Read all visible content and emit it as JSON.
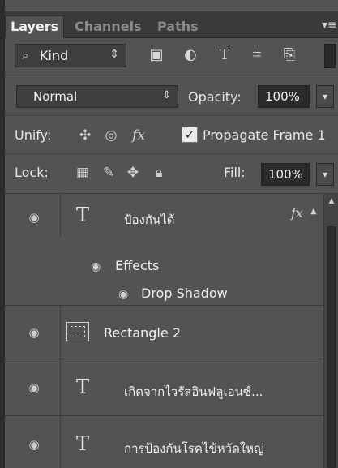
{
  "tabs": [
    {
      "label": "Layers",
      "active": true
    },
    {
      "label": "Channels",
      "active": false
    },
    {
      "label": "Paths",
      "active": false
    }
  ],
  "panel_menu_icon": "panel-menu-icon",
  "filter": {
    "kind_label": "Kind",
    "icons": [
      "image-filter-icon",
      "adjustment-filter-icon",
      "type-filter-icon",
      "shape-filter-icon",
      "smart-object-filter-icon"
    ]
  },
  "blend": {
    "mode": "Normal",
    "opacity_label": "Opacity:",
    "opacity_value": "100%"
  },
  "unify": {
    "label": "Unify:",
    "icons": [
      "unify-position-icon",
      "unify-visibility-icon",
      "unify-style-icon"
    ],
    "propagate_label": "Propagate Frame 1",
    "propagate_checked": true
  },
  "lock": {
    "label": "Lock:",
    "icons": [
      "lock-transparent-pixels-icon",
      "lock-image-pixels-icon",
      "lock-position-icon",
      "lock-all-icon"
    ],
    "fill_label": "Fill:",
    "fill_value": "100%"
  },
  "layers": [
    {
      "type": "text",
      "name": "ป้องกันได้",
      "has_fx": true,
      "fx_label": "fx",
      "effects_label": "Effects",
      "effects": [
        "Drop Shadow"
      ]
    },
    {
      "type": "shape",
      "name": "Rectangle 2"
    },
    {
      "type": "text",
      "name": "เกิดจากไวรัสอินฟลูเอนซ์..."
    },
    {
      "type": "text",
      "name": "การป้องกันโรคไข้หวัดใหญ่"
    }
  ],
  "text_layer_glyph": "T",
  "colors": {
    "panel_bg": "#535353",
    "tabbar_bg": "#3a3a3a",
    "field_bg": "#2b2b2b"
  }
}
